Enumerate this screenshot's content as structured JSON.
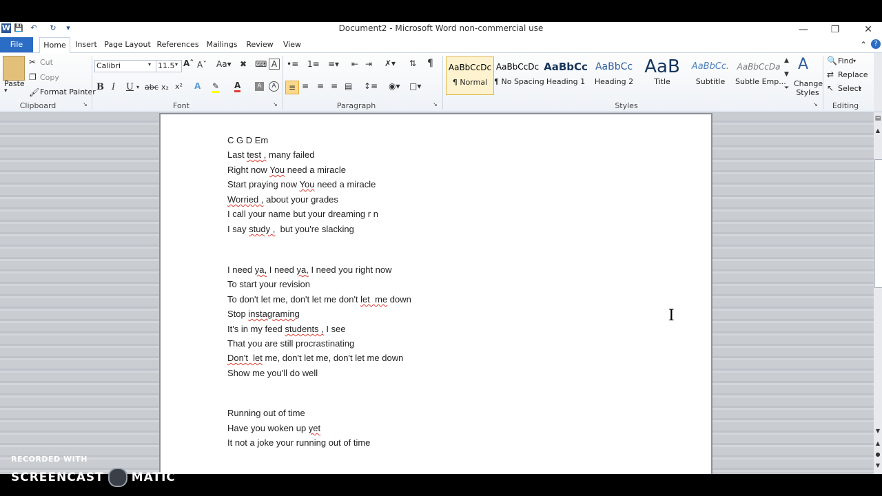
{
  "window": {
    "title": "Document2 - Microsoft Word non-commercial use",
    "icons": [
      "word-icon",
      "save-icon",
      "undo-icon",
      "redo-icon",
      "customize-icon"
    ]
  },
  "tabs": [
    "File",
    "Home",
    "Insert",
    "Page Layout",
    "References",
    "Mailings",
    "Review",
    "View"
  ],
  "clipboard": {
    "paste": "Paste",
    "cut": "Cut",
    "copy": "Copy",
    "format_painter": "Format Painter",
    "label": "Clipboard"
  },
  "font": {
    "name": "Calibri",
    "size": "11.5",
    "label": "Font",
    "bold": "B",
    "italic": "I",
    "underline": "U"
  },
  "paragraph": {
    "label": "Paragraph",
    "show_marks": "¶"
  },
  "styles": {
    "label": "Styles",
    "items": [
      {
        "sample": "AaBbCcDc",
        "name": "¶ Normal"
      },
      {
        "sample": "AaBbCcDc",
        "name": "¶ No Spacing"
      },
      {
        "sample": "AaBbCc",
        "name": "Heading 1"
      },
      {
        "sample": "AaBbCc",
        "name": "Heading 2"
      },
      {
        "sample": "AaB",
        "name": "Title"
      },
      {
        "sample": "AaBbCc.",
        "name": "Subtitle"
      },
      {
        "sample": "AaBbCcDa",
        "name": "Subtle Emp..."
      }
    ],
    "change_styles": "Change Styles"
  },
  "editing": {
    "find": "Find",
    "replace": "Replace",
    "select": "Select",
    "label": "Editing"
  },
  "document": {
    "lines": [
      [
        {
          "t": "C G D Em"
        }
      ],
      [
        {
          "t": "Last "
        },
        {
          "t": "test ,",
          "sq": true
        },
        {
          "t": " many failed"
        }
      ],
      [
        {
          "t": "Right now "
        },
        {
          "t": "You",
          "sq": true
        },
        {
          "t": " need a miracle"
        }
      ],
      [
        {
          "t": "Start praying now "
        },
        {
          "t": "You",
          "sq": true
        },
        {
          "t": " need a miracle"
        }
      ],
      [
        {
          "t": "Worried ,",
          "sq": true
        },
        {
          "t": " about your grades"
        }
      ],
      [
        {
          "t": "I call your name but your dreaming r n"
        }
      ],
      [
        {
          "t": "I say "
        },
        {
          "t": "study ,",
          "sq": true
        },
        {
          "t": "  but you're slacking"
        }
      ],
      [
        {
          "t": "I need "
        },
        {
          "t": "ya,",
          "sq": true
        },
        {
          "t": " I need "
        },
        {
          "t": "ya,",
          "sq": true
        },
        {
          "t": " I need you right now"
        }
      ],
      [
        {
          "t": "To start your revision"
        }
      ],
      [
        {
          "t": "To don't let me, don't let me don't "
        },
        {
          "t": "let  me",
          "sq": true
        },
        {
          "t": " down"
        }
      ],
      [
        {
          "t": "Stop "
        },
        {
          "t": "instagraming",
          "sq": true
        }
      ],
      [
        {
          "t": "It's in my feed "
        },
        {
          "t": "students ,",
          "sq": true
        },
        {
          "t": " I see"
        }
      ],
      [
        {
          "t": "That you are still procrastinating"
        }
      ],
      [
        {
          "t": "Don't  let",
          "sq": true
        },
        {
          "t": " me, don't let me, don't let me down"
        }
      ],
      [
        {
          "t": "Show me you'll do well"
        }
      ],
      [
        {
          "t": "Running out of time"
        }
      ],
      [
        {
          "t": "Have you woken up "
        },
        {
          "t": "yet",
          "sq": true
        }
      ],
      [
        {
          "t": "It not a joke your running out of time"
        }
      ]
    ]
  },
  "watermark": {
    "line1": "RECORDED WITH",
    "line2a": "SCREENCAST",
    "line2b": "MATIC"
  }
}
